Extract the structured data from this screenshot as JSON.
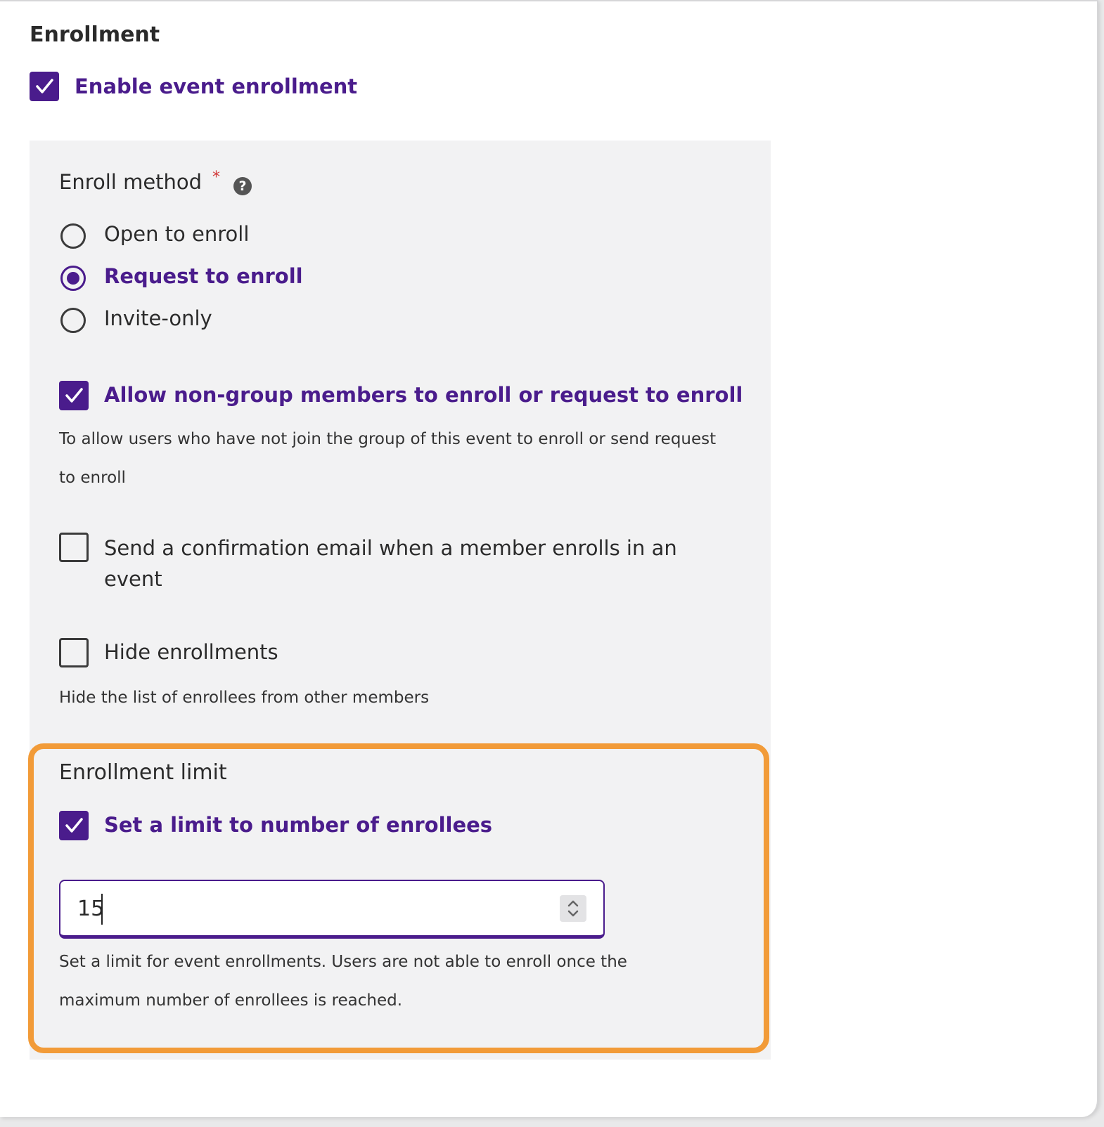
{
  "section": {
    "title": "Enrollment"
  },
  "enable_enrollment": {
    "label": "Enable event enrollment",
    "checked": true
  },
  "enroll_method": {
    "label": "Enroll method",
    "required_mark": "*",
    "help_glyph": "?",
    "options": [
      {
        "label": "Open to enroll",
        "selected": false
      },
      {
        "label": "Request to enroll",
        "selected": true
      },
      {
        "label": "Invite-only",
        "selected": false
      }
    ]
  },
  "allow_non_group": {
    "label": "Allow non-group members to enroll or request to enroll",
    "checked": true,
    "help": "To allow users who have not join the group of this event to enroll or send request to enroll"
  },
  "confirmation_email": {
    "label": "Send a confirmation email when a member enrolls in an event",
    "checked": false
  },
  "hide_enrollments": {
    "label": "Hide enrollments",
    "checked": false,
    "help": "Hide the list of enrollees from other members"
  },
  "enrollment_limit": {
    "title": "Enrollment limit",
    "set_limit_label": "Set a limit to number of enrollees",
    "checked": true,
    "value": "15",
    "help": "Set a limit for event enrollments. Users are not able to enroll once the maximum number of enrollees is reached."
  },
  "colors": {
    "accent": "#4a1c8c",
    "highlight": "#f29b38",
    "required": "#d23b3b",
    "panel": "#f2f2f3"
  }
}
